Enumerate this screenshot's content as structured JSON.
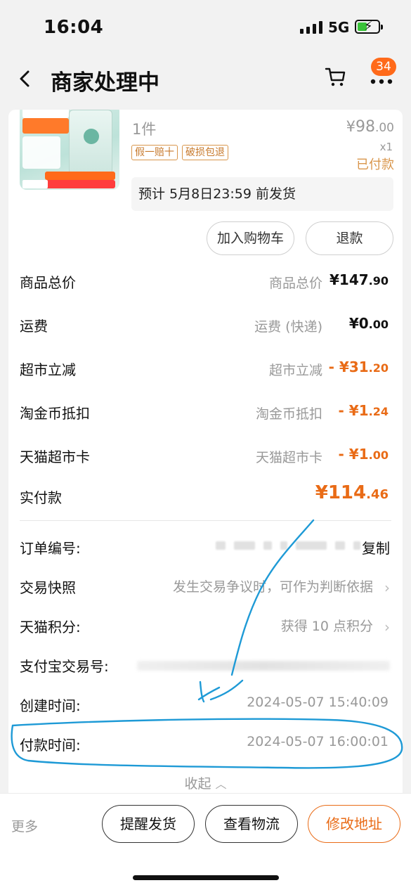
{
  "status_bar": {
    "time": "16:04",
    "network": "5G",
    "battery_icon": "battery-charging-icon",
    "signal_icon": "signal-bars-icon"
  },
  "nav": {
    "title": "商家处理中",
    "cart_badge": "34",
    "back_icon": "chevron-left-icon",
    "cart_icon": "cart-icon",
    "more_icon": "more-dots-icon"
  },
  "product": {
    "quantity_label": "1件",
    "price_symbol": "¥",
    "price_int": "98",
    "price_dec": ".00",
    "count": "x1",
    "status": "已付款",
    "tags": [
      "假一赔十",
      "破损包退"
    ],
    "ship_estimate": "预计 5月8日23:59 前发货",
    "add_cart_label": "加入购物车",
    "refund_label": "退款"
  },
  "summary": [
    {
      "label": "商品总价",
      "sub": "商品总价",
      "prefix": "¥",
      "int": "147",
      "dec": ".90",
      "style": "normal"
    },
    {
      "label": "运费",
      "sub": "运费 (快递)",
      "prefix": "¥",
      "int": "0",
      "dec": ".00",
      "style": "normal"
    },
    {
      "label": "超市立减",
      "sub": "超市立减",
      "prefix": "- ¥",
      "int": "31",
      "dec": ".20",
      "style": "neg"
    },
    {
      "label": "淘金币抵扣",
      "sub": "淘金币抵扣",
      "prefix": "- ¥",
      "int": "1",
      "dec": ".24",
      "style": "neg"
    },
    {
      "label": "天猫超市卡",
      "sub": "天猫超市卡",
      "prefix": "- ¥",
      "int": "1",
      "dec": ".00",
      "style": "neg"
    },
    {
      "label": "实付款",
      "sub": "",
      "prefix": "¥",
      "int": "114",
      "dec": ".46",
      "style": "total"
    }
  ],
  "info": {
    "order_no_label": "订单编号:",
    "copy_label": "复制",
    "snapshot_label": "交易快照",
    "snapshot_value": "发生交易争议时，可作为判断依据",
    "points_label": "天猫积分:",
    "points_value": "获得 10 点积分",
    "alipay_label": "支付宝交易号:",
    "created_label": "创建时间:",
    "created_value": "2024-05-07 15:40:09",
    "paid_label": "付款时间:",
    "paid_value": "2024-05-07 16:00:01"
  },
  "collapse_label": "收起",
  "bottom": {
    "more_label": "更多",
    "remind_label": "提醒发货",
    "logistics_label": "查看物流",
    "address_label": "修改地址"
  },
  "colors": {
    "accent": "#e96b16",
    "badge": "#ff6a1a",
    "tag": "#c77a2d",
    "annotation": "#1e9ad6"
  }
}
